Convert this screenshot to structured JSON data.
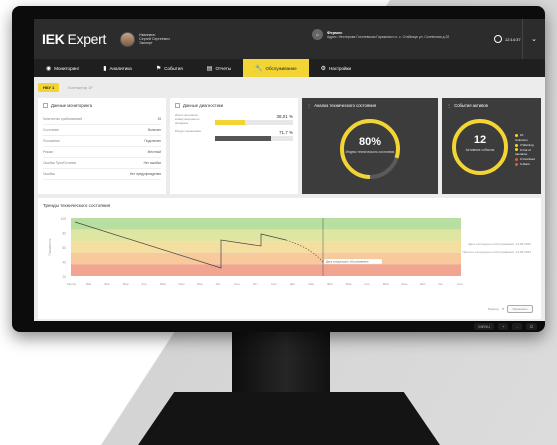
{
  "app": {
    "brand_bold": "IEK",
    "brand_rest": " Expert"
  },
  "user": {
    "name": "Иванович",
    "sub": "Сергей Сергеевич",
    "role": "Эксперт"
  },
  "station": {
    "title": "Фермес",
    "address": "Адрес: Нестерова Гоголевская Гаражная п.о. с. Стаблице ул. Солнечная д.32"
  },
  "clock": {
    "time": "12:14:37"
  },
  "nav": [
    {
      "label": "Мониторинг",
      "icon": "eye-icon"
    },
    {
      "label": "Аналитика",
      "icon": "bars-icon"
    },
    {
      "label": "События",
      "icon": "flag-icon"
    },
    {
      "label": "Отчеты",
      "icon": "document-icon"
    },
    {
      "label": "Обслуживание",
      "icon": "wrench-icon",
      "active": true
    },
    {
      "label": "Настройки",
      "icon": "gear-icon"
    }
  ],
  "tabs": [
    {
      "label": "НКУ 1",
      "active": true
    },
    {
      "label": "Контактор 1F",
      "active": false
    }
  ],
  "monitoring": {
    "title": "Данные мониторинга",
    "rows": [
      {
        "k": "Количество срабатываний",
        "v": "15"
      },
      {
        "k": "Состояние",
        "v": "Включен"
      },
      {
        "k": "Положение",
        "v": "Подключен"
      },
      {
        "k": "Режим",
        "v": "Местный"
      },
      {
        "k": "Ошибка Пуск/Останов",
        "v": "Нет ошибки"
      },
      {
        "k": "Ошибка",
        "v": "Нет предупреждения"
      }
    ]
  },
  "diagnostics": {
    "title": "Данные диагностики",
    "items": [
      {
        "label": "Износ контактов коммутационного аппарата",
        "value": "38,01 %",
        "fill": 38.01,
        "color": "#f2d434"
      },
      {
        "label": "Ресурс механизма",
        "value": "71,7 %",
        "fill": 71.7,
        "color": "#555555"
      }
    ]
  },
  "tech_state": {
    "title": "Анализ технического состояния",
    "value": "80%",
    "percent": 80,
    "label": "Индекс технического состояния"
  },
  "events": {
    "title": "События активов",
    "count": "12",
    "label": "Активные события",
    "legend": [
      {
        "name": "10 Unknown",
        "color": "#f2d434"
      },
      {
        "name": "3 Warning",
        "color": "#f2d434"
      },
      {
        "name": "0 Out of tolerance",
        "color": "#f2d434"
      },
      {
        "name": "0 Overload",
        "color": "#e05a3a"
      },
      {
        "name": "0 Alarm",
        "color": "#e05a3a"
      }
    ]
  },
  "trend": {
    "title": "Тренды технического состояния",
    "ylabel": "Показатель",
    "legend": [
      "Дата последнего обслуживания: 11.08.2022",
      "Прогноз следующего обслуживания: 11.08.2023"
    ],
    "marker_label": "Дата следующего обслуживания",
    "xlabels": [
      "Месяц",
      "Янв",
      "Фев",
      "Мар",
      "Апр",
      "Май",
      "Июн",
      "Июл",
      "Авг",
      "Сен",
      "Окт",
      "Ноя",
      "Дек",
      "Янв",
      "Фев",
      "Мар",
      "Апр",
      "Май",
      "Июн",
      "Июл",
      "Авг",
      "Сен"
    ],
    "ylabels": [
      "100",
      "80",
      "60",
      "40",
      "20"
    ],
    "period_label": "Период",
    "apply": "Применить",
    "zones": [
      "#b8dfa0",
      "#dfe6a2",
      "#f4dea0",
      "#f8c99a",
      "#f1a48f"
    ]
  },
  "bezel": [
    "MENU",
    "+",
    "-",
    "⏻"
  ]
}
